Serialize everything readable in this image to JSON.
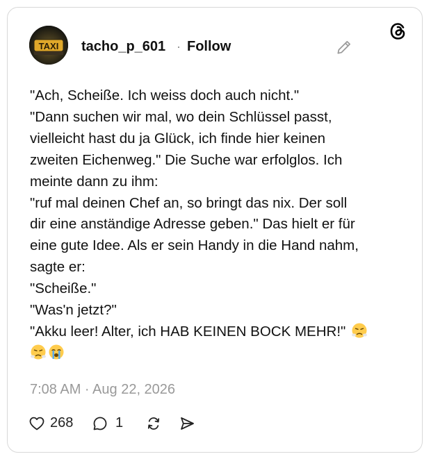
{
  "post": {
    "username": "tacho_p_601",
    "separator": "·",
    "follow_label": "Follow",
    "avatar_sign_text": "TAXI",
    "text_lines": [
      "\"Ach, Scheiße. Ich weiss doch auch nicht.\"",
      "\"Dann suchen wir mal, wo dein Schlüssel passt,",
      "vielleicht hast du ja Glück, ich finde hier keinen",
      "zweiten Eichenweg.\" Die Suche war erfolglos. Ich",
      "meinte dann zu ihm:",
      "\"ruf mal deinen Chef an, so bringt das nix. Der soll",
      "dir eine anständige Adresse geben.\" Das hielt er für",
      "eine gute Idee. Als er sein Handy in die Hand nahm,",
      "sagte er:",
      "\"Scheiße.\"",
      "\"Was'n jetzt?\"",
      "\"Akku leer! Alter, ich HAB KEINEN BOCK MEHR!\""
    ],
    "emojis_inline": [
      "steam-from-nose"
    ],
    "emojis_row": [
      "steam-from-nose",
      "loudly-crying"
    ],
    "timestamp": "7:08 AM · Aug 22, 2026",
    "likes": "268",
    "replies": "1"
  },
  "icons": {
    "platform": "threads-logo-icon",
    "edit": "pencil-icon",
    "like": "heart-icon",
    "reply": "speech-bubble-icon",
    "repost": "repost-icon",
    "share": "send-icon"
  }
}
